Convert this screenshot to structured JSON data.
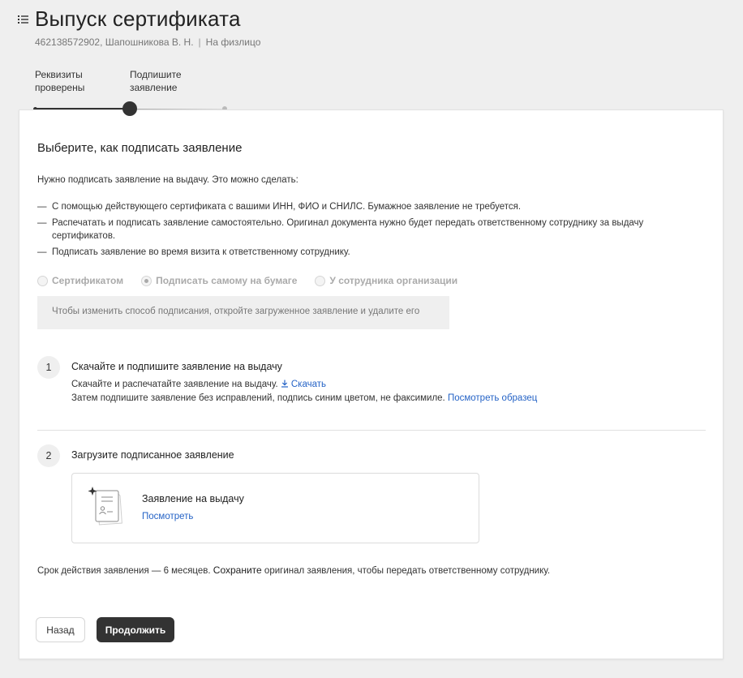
{
  "header": {
    "title": "Выпуск сертификата",
    "meta_id": "462138572902, Шапошникова В. Н.",
    "meta_separator": "|",
    "meta_type": "На физлицо"
  },
  "stepper": {
    "steps": [
      {
        "line1": "Реквизиты",
        "line2": "проверены",
        "state": "done"
      },
      {
        "line1": "Подпишите",
        "line2": "заявление",
        "state": "active"
      }
    ]
  },
  "card": {
    "heading": "Выберите, как подписать заявление",
    "intro": "Нужно подписать заявление на выдачу. Это можно сделать:",
    "dash": "—",
    "options": [
      "С помощью действующего сертификата с вашими ИНН, ФИО и СНИЛС. Бумажное заявление не требуется.",
      "Распечатать и подписать заявление самостоятельно. Оригинал документа нужно будет передать ответственному сотруднику за выдачу сертификатов.",
      "Подписать заявление во время визита к ответственному сотруднику."
    ],
    "radios": [
      {
        "label": "Сертификатом",
        "checked": false
      },
      {
        "label": "Подписать самому на бумаге",
        "checked": true
      },
      {
        "label": "У сотрудника организации",
        "checked": false
      }
    ],
    "note": "Чтобы изменить способ подписания, откройте загруженное заявление и удалите его",
    "step1": {
      "number": "1",
      "title": "Скачайте и подпишите заявление на выдачу",
      "text_a": "Скачайте и распечатайте заявление на выдачу.",
      "download_link": "Скачать",
      "text_b": "Затем подпишите заявление без исправлений, подпись синим цветом, не факсимиле.",
      "sample_link": "Посмотреть образец"
    },
    "step2": {
      "number": "2",
      "title": "Загрузите подписанное заявление",
      "doc_title": "Заявление на выдачу",
      "doc_link": "Посмотреть"
    },
    "validity_prefix": "Срок действия заявления — 6 месяцев.",
    "validity_bold": "Сохраните",
    "validity_suffix": "оригинал заявления, чтобы передать ответственному сотруднику.",
    "back_label": "Назад",
    "continue_label": "Продолжить"
  },
  "colors": {
    "accent_link": "#2563c6",
    "dark_button": "#333333",
    "background": "#efefef"
  }
}
